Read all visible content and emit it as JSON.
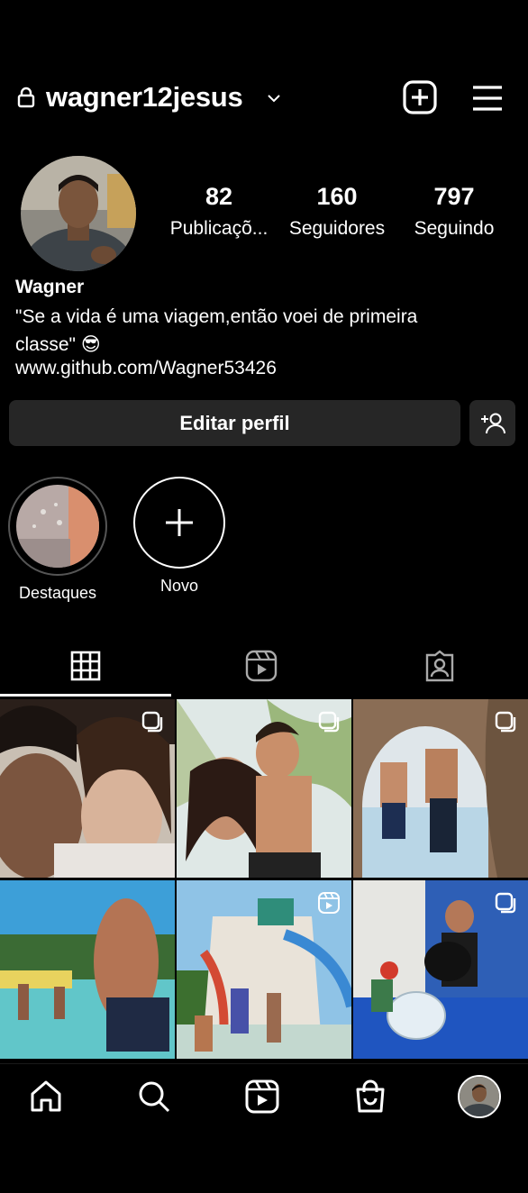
{
  "header": {
    "username": "wagner12jesus"
  },
  "profile": {
    "stats": [
      {
        "value": "82",
        "label": "Publicaçõ..."
      },
      {
        "value": "160",
        "label": "Seguidores"
      },
      {
        "value": "797",
        "label": "Seguindo"
      }
    ],
    "name": "Wagner",
    "bio": "\"Se a vida é uma viagem,então voei de primeira classe\" 😎",
    "link": "www.github.com/Wagner53426"
  },
  "actions": {
    "edit_profile": "Editar perfil"
  },
  "highlights": [
    {
      "label": "Destaques"
    },
    {
      "label": "Novo"
    }
  ],
  "tabs": [
    "grid-icon",
    "reels-icon",
    "tagged-icon"
  ],
  "posts": [
    {
      "badge": "carousel-icon"
    },
    {
      "badge": "carousel-icon"
    },
    {
      "badge": "carousel-icon"
    },
    {
      "badge": "none"
    },
    {
      "badge": "reels-icon"
    },
    {
      "badge": "carousel-icon"
    }
  ],
  "bottom_nav": [
    "home-icon",
    "search-icon",
    "reels-icon",
    "shop-icon",
    "profile-avatar"
  ],
  "colors": {
    "background": "#000000",
    "button": "#262626",
    "text": "#ffffff"
  }
}
